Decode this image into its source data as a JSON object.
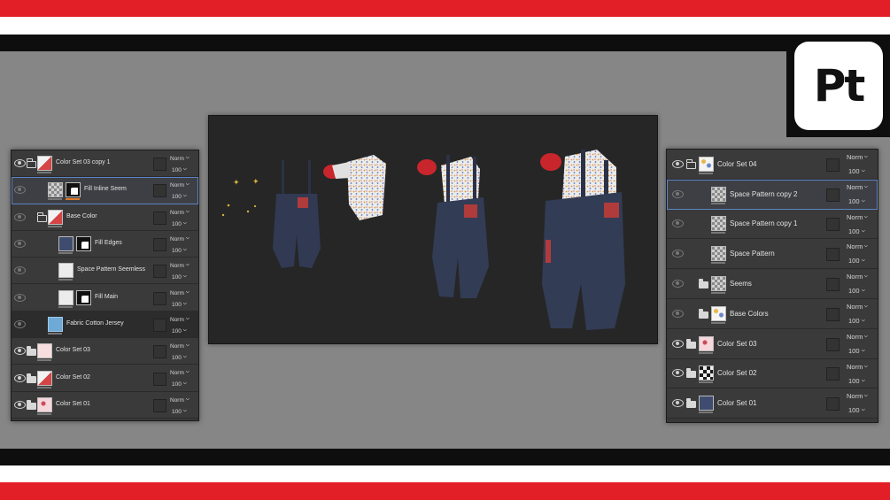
{
  "logo": {
    "text": "Pt"
  },
  "left_panel": {
    "layers": [
      {
        "name": "Color Set 03 copy 1",
        "blend": "Norm",
        "opacity": "100",
        "icon": "folder-open-icon",
        "thumb": "t-mix",
        "eye": "on",
        "indent": 0
      },
      {
        "name": "Fill Inline Seem",
        "blend": "Norm",
        "opacity": "100",
        "icon": "",
        "thumb": "t-checker",
        "mask": true,
        "eye": "dim",
        "indent": 1,
        "selected": true,
        "orange": true
      },
      {
        "name": "Base Color",
        "blend": "Norm",
        "opacity": "100",
        "icon": "folder-open-icon",
        "thumb": "t-mix",
        "eye": "dim",
        "indent": 1
      },
      {
        "name": "Fill Edges",
        "blend": "Norm",
        "opacity": "100",
        "icon": "",
        "thumb": "t-navy",
        "mask": true,
        "eye": "dim",
        "indent": 2
      },
      {
        "name": "Space Pattern Seemless",
        "blend": "Norm",
        "opacity": "100",
        "icon": "",
        "thumb": "t-white",
        "eye": "dim",
        "indent": 2
      },
      {
        "name": "Fill Main",
        "blend": "Norm",
        "opacity": "100",
        "icon": "",
        "thumb": "t-white",
        "mask": true,
        "eye": "dim",
        "indent": 2
      },
      {
        "name": "Fabric Cotton Jersey",
        "blend": "Norm",
        "opacity": "100",
        "icon": "",
        "thumb": "t-blue",
        "eye": "dim",
        "indent": 1,
        "dark": true
      },
      {
        "name": "Color Set 03",
        "blend": "Norm",
        "opacity": "100",
        "icon": "folder-icon",
        "thumb": "t-pink",
        "eye": "on",
        "indent": 0
      },
      {
        "name": "Color Set 02",
        "blend": "Norm",
        "opacity": "100",
        "icon": "folder-icon",
        "thumb": "t-mix",
        "eye": "on",
        "indent": 0
      },
      {
        "name": "Color Set 01",
        "blend": "Norm",
        "opacity": "100",
        "icon": "folder-icon",
        "thumb": "t-pinkfloral",
        "eye": "on",
        "indent": 0
      }
    ]
  },
  "right_panel": {
    "layers": [
      {
        "name": "Color Set 04",
        "blend": "Norm",
        "opacity": "100",
        "icon": "folder-open-icon",
        "thumb": "t-floral",
        "eye": "on",
        "indent": 0
      },
      {
        "name": "Space Pattern copy 2",
        "blend": "Norm",
        "opacity": "100",
        "icon": "",
        "thumb": "t-checker",
        "eye": "dim",
        "indent": 1,
        "selected": true
      },
      {
        "name": "Space Pattern copy 1",
        "blend": "Norm",
        "opacity": "100",
        "icon": "",
        "thumb": "t-checker",
        "eye": "dim",
        "indent": 1
      },
      {
        "name": "Space Pattern",
        "blend": "Norm",
        "opacity": "100",
        "icon": "",
        "thumb": "t-checker",
        "eye": "dim",
        "indent": 1
      },
      {
        "name": "Seems",
        "blend": "Norm",
        "opacity": "100",
        "icon": "folder-icon",
        "thumb": "t-checker",
        "eye": "dim",
        "indent": 1
      },
      {
        "name": "Base Colors",
        "blend": "Norm",
        "opacity": "100",
        "icon": "folder-icon",
        "thumb": "t-floral",
        "eye": "dim",
        "indent": 1
      },
      {
        "name": "Color Set 03",
        "blend": "Norm",
        "opacity": "100",
        "icon": "folder-icon",
        "thumb": "t-pinkfloral",
        "eye": "on",
        "indent": 0
      },
      {
        "name": "Color Set 02",
        "blend": "Norm",
        "opacity": "100",
        "icon": "folder-icon",
        "thumb": "t-dark",
        "eye": "on",
        "indent": 0
      },
      {
        "name": "Color Set 01",
        "blend": "Norm",
        "opacity": "100",
        "icon": "folder-icon",
        "thumb": "t-navy",
        "eye": "on",
        "indent": 0
      }
    ]
  },
  "colors": {
    "brand_red": "#e21f26",
    "selection": "#5c84c4",
    "panel_bg": "#383838",
    "viewport_bg": "#262626"
  }
}
